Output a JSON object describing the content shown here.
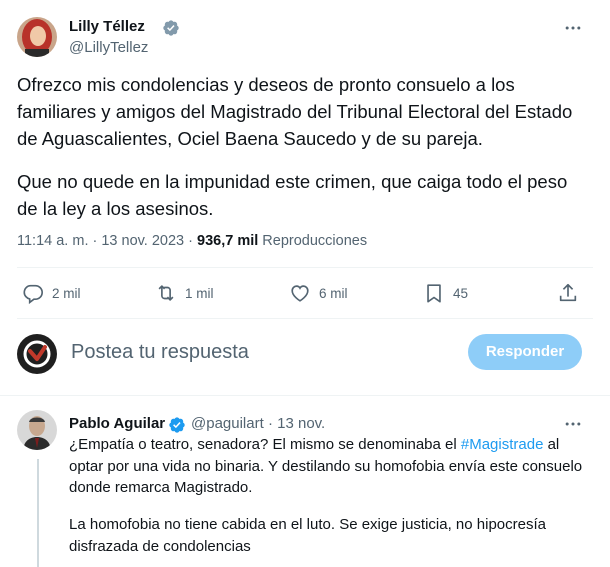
{
  "tweet": {
    "author_name": "Lilly Téllez",
    "author_handle": "@LillyTellez",
    "paragraph1": "Ofrezco mis condolencias y deseos de pronto consuelo a los familiares y amigos del Magistrado del Tribunal Electoral del Estado de Aguascalientes, Ociel Baena Saucedo y de su pareja.",
    "paragraph2": "Que no quede en la impunidad este crimen, que caiga todo el peso de la ley a los asesinos.",
    "time": "11:14 a. m. · 13 nov. 2023 · ",
    "views_count": "936,7 mil",
    "views_label": " Reproducciones"
  },
  "actions": {
    "replies": "2 mil",
    "retweets": "1 mil",
    "likes": "6 mil",
    "bookmarks": "45"
  },
  "compose": {
    "placeholder": "Postea tu respuesta",
    "reply_button": "Responder"
  },
  "reply": {
    "author_name": "Pablo Aguilar",
    "author_handle": "@paguilart",
    "separator": " · ",
    "date": "13 nov.",
    "text_before_hashtag": "¿Empatía o teatro, senadora? El mismo se denominaba el ",
    "hashtag": "#Magistrade",
    "text_after_hashtag": " al optar por una vida no binaria. Y destilando su homofobia envía este consuelo donde remarca Magistrado.",
    "paragraph2": "La homofobia no tiene cabida en el luto. Se exige justicia, no hipocresía disfrazada de condolencias"
  },
  "colors": {
    "accent": "#1d9bf0",
    "reply_button_disabled": "#8ecdf8",
    "secondary_text": "#536471"
  }
}
